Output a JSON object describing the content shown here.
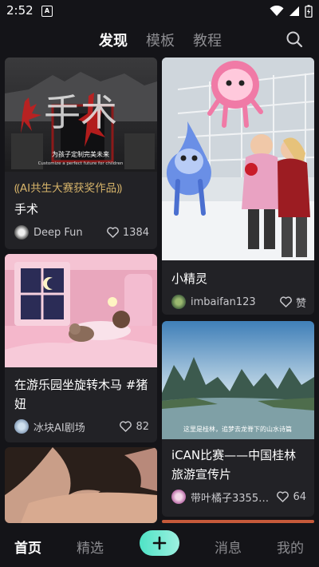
{
  "status_bar": {
    "time": "2:52",
    "notification_letter": "A"
  },
  "top_tabs": [
    {
      "label": "发现",
      "active": true
    },
    {
      "label": "模板",
      "active": false
    },
    {
      "label": "教程",
      "active": false
    }
  ],
  "cards": [
    {
      "image_text": "手术",
      "image_caption": "为孩子定制完美未来",
      "image_subcaption": "Customize a perfect future for children",
      "award": "AI共生大赛获奖作品",
      "title": "手术",
      "author": "Deep Fun",
      "likes": "1384"
    },
    {
      "title": "小精灵",
      "author": "imbaifan123",
      "likes": "赞"
    },
    {
      "title": "在游乐园坐旋转木马 #猪妞",
      "author": "冰块AI剧场",
      "likes": "82"
    },
    {
      "image_overlay_text": "这里是桂林，追梦去龙脊下的山水诗篇",
      "title": "iCAN比赛——中国桂林旅游宣传片",
      "author": "带叶橘子33550...",
      "likes": "64"
    }
  ],
  "bottom_nav": [
    {
      "label": "首页",
      "active": true
    },
    {
      "label": "精选",
      "active": false
    },
    {
      "label": "消息",
      "active": false
    },
    {
      "label": "我的",
      "active": false
    }
  ],
  "colors": {
    "background": "#141418",
    "card": "#222226",
    "award": "#d7b46a",
    "add_button": "#4fe3c6"
  }
}
